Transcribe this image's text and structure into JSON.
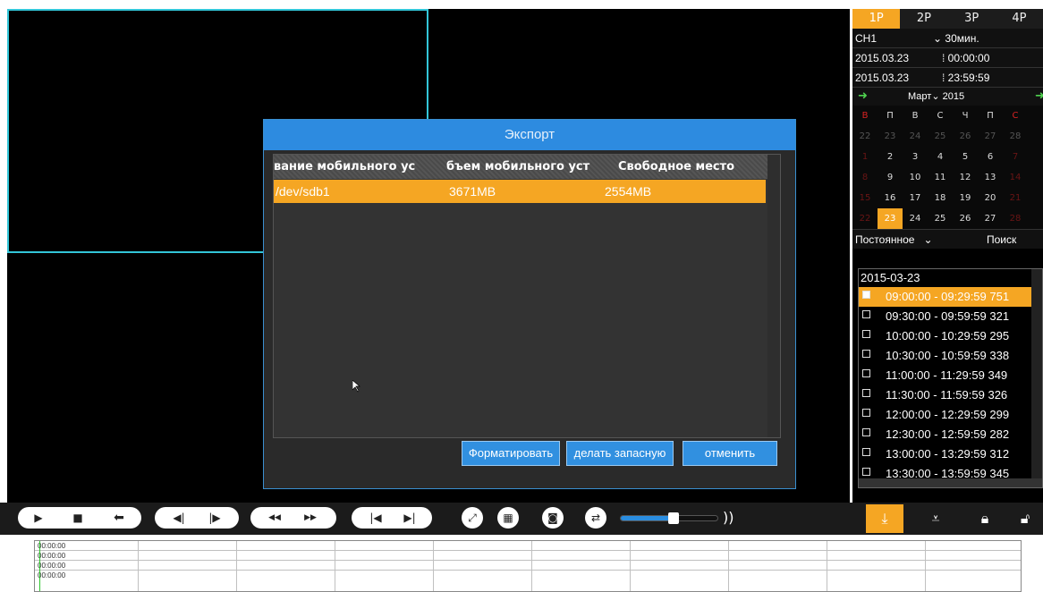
{
  "split_tabs": [
    "1P",
    "2P",
    "3P",
    "4P"
  ],
  "controls": {
    "channel": "CH1",
    "interval": "30мин.",
    "start_date": "2015.03.23",
    "start_time": "00:00:00",
    "end_date": "2015.03.23",
    "end_time": "23:59:59"
  },
  "calendar": {
    "month_label": "Март",
    "year_label": "2015",
    "weekdays": [
      "В",
      "П",
      "В",
      "С",
      "Ч",
      "П",
      "С"
    ],
    "days": [
      [
        "22",
        "23",
        "24",
        "25",
        "26",
        "27",
        "28"
      ],
      [
        "1",
        "2",
        "3",
        "4",
        "5",
        "6",
        "7"
      ],
      [
        "8",
        "9",
        "10",
        "11",
        "12",
        "13",
        "14"
      ],
      [
        "15",
        "16",
        "17",
        "18",
        "19",
        "20",
        "21"
      ],
      [
        "22",
        "23",
        "24",
        "25",
        "26",
        "27",
        "28"
      ]
    ],
    "selected_day": "23"
  },
  "record_type": "Постоянное",
  "search_label": "Поиск",
  "file_list": {
    "date": "2015-03-23",
    "items": [
      {
        "time": "09:00:00 - 09:29:59",
        "size": "751",
        "checked": true
      },
      {
        "time": "09:30:00 - 09:59:59",
        "size": "321",
        "checked": false
      },
      {
        "time": "10:00:00 - 10:29:59",
        "size": "295",
        "checked": false
      },
      {
        "time": "10:30:00 - 10:59:59",
        "size": "338",
        "checked": false
      },
      {
        "time": "11:00:00 - 11:29:59",
        "size": "349",
        "checked": false
      },
      {
        "time": "11:30:00 - 11:59:59",
        "size": "326",
        "checked": false
      },
      {
        "time": "12:00:00 - 12:29:59",
        "size": "299",
        "checked": false
      },
      {
        "time": "12:30:00 - 12:59:59",
        "size": "282",
        "checked": false
      },
      {
        "time": "13:00:00 - 13:29:59",
        "size": "312",
        "checked": false
      },
      {
        "time": "13:30:00 - 13:59:59",
        "size": "345",
        "checked": false
      }
    ]
  },
  "dialog": {
    "title": "Экспорт",
    "columns": [
      "вание мобильного ус",
      "бъем мобильного уст",
      "Свободное место"
    ],
    "row": {
      "device": "/dev/sdb1",
      "capacity": "3671MB",
      "free": "2554MB"
    },
    "buttons": {
      "format": "Форматировать",
      "backup": "делать запасную",
      "cancel": "отменить"
    }
  },
  "volume": {
    "level_percent": 55,
    "icon": "speaker-waves-icon"
  },
  "timeline": {
    "labels": [
      "00:00:00",
      "00:00:00",
      "00:00:00",
      "00:00:00"
    ]
  },
  "colors": {
    "accent": "#f5a623",
    "dialog_title": "#2d8be0",
    "selection_border": "#33c6d8"
  }
}
